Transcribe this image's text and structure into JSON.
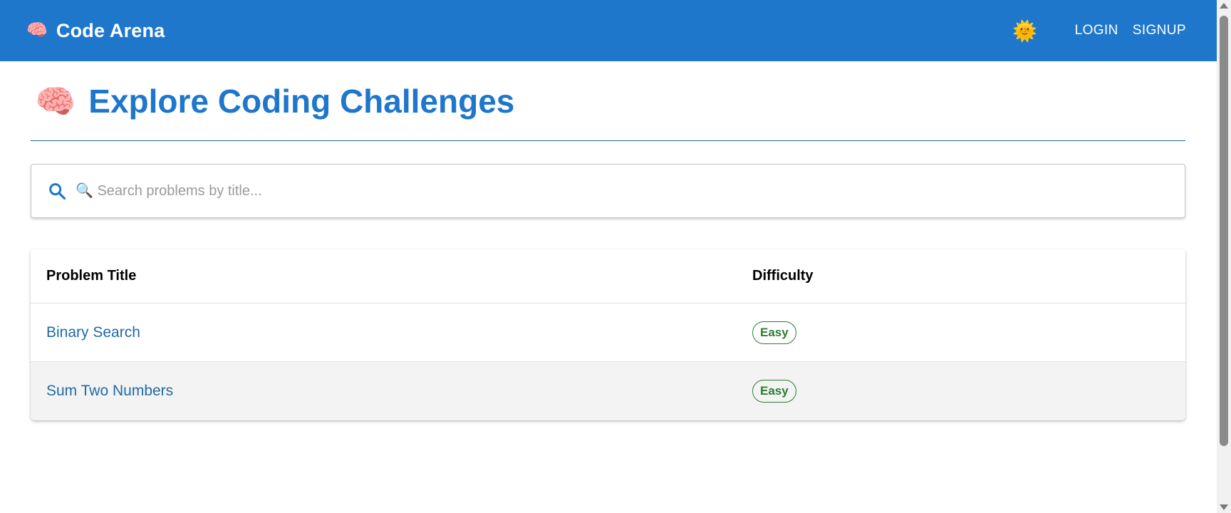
{
  "appbar": {
    "brand_icon": "🧠",
    "brand_name": "Code Arena",
    "theme_icon": "🌞",
    "nav": [
      {
        "label": "LOGIN"
      },
      {
        "label": "SIGNUP"
      }
    ]
  },
  "page": {
    "title_icon": "🧠",
    "title": "Explore Coding Challenges"
  },
  "search": {
    "icon": "search-icon",
    "placeholder": "🔍 Search problems by title...",
    "value": ""
  },
  "table": {
    "columns": [
      "Problem Title",
      "Difficulty"
    ],
    "rows": [
      {
        "title": "Binary Search",
        "difficulty": "Easy"
      },
      {
        "title": "Sum Two Numbers",
        "difficulty": "Easy"
      }
    ]
  },
  "colors": {
    "primary": "#1f77cc",
    "link": "#1f6aa8",
    "easy": "#2e7d32"
  }
}
